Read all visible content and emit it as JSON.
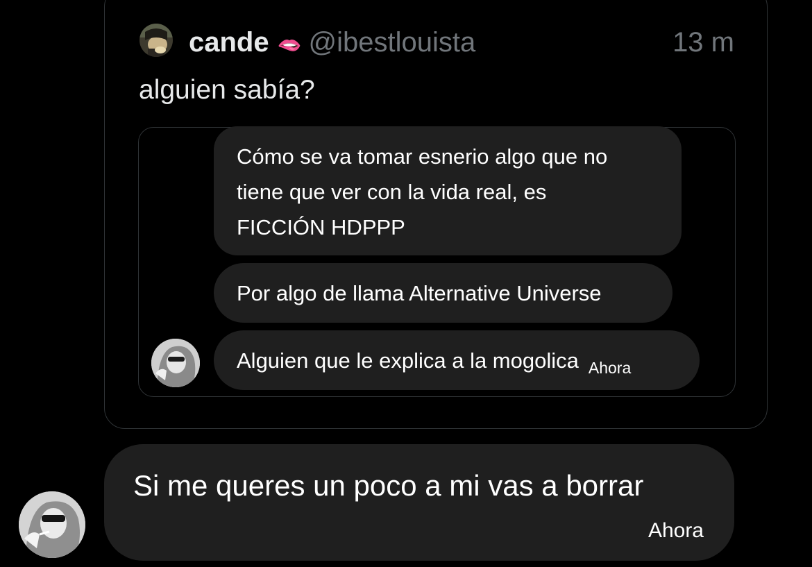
{
  "quoted_tweet": {
    "author_name": "cande",
    "name_emoji": "🫦",
    "handle": "@ibestlouista",
    "time": "13 m",
    "text": "alguien sabía?",
    "screenshot": {
      "messages": [
        {
          "lines": [
            "Cómo se va tomar esnerio algo que no",
            "tiene que ver con la vida real, es",
            "FICCIÓN HDPPP"
          ]
        },
        {
          "text": "Por algo de llama Alternative Universe"
        },
        {
          "text": "Alguien que le explica a la mogolica",
          "time": "Ahora"
        }
      ]
    }
  },
  "reply_message": {
    "text": "Si me queres un poco a mi vas a borrar",
    "time": "Ahora"
  },
  "icons": {
    "tweet_avatar": "user-avatar-icon",
    "inner_avatar": "user-avatar-icon",
    "main_avatar": "user-avatar-icon"
  },
  "colors": {
    "background": "#000000",
    "bubble": "#1f1f1f",
    "border": "#2f3336",
    "secondary_text": "#71767b"
  }
}
